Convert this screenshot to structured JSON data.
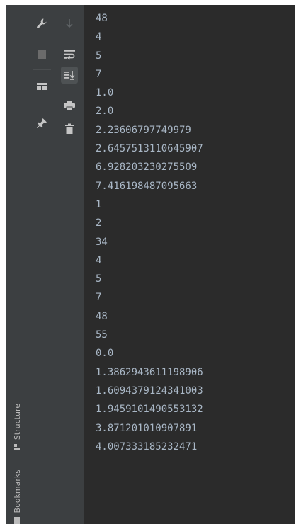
{
  "sidebar": {
    "tabs": [
      {
        "label": "Structure",
        "icon": "structure-icon"
      },
      {
        "label": "Bookmarks",
        "icon": "bookmarks-icon"
      }
    ]
  },
  "toolbar": {
    "col1": [
      {
        "name": "wrench-icon",
        "title": "Settings"
      },
      {
        "name": "stop-icon",
        "title": "Stop"
      },
      {
        "name": "layout-icon",
        "title": "Layout"
      },
      {
        "name": "pin-icon",
        "title": "Pin"
      }
    ],
    "col2": [
      {
        "name": "arrow-down-icon",
        "title": "Down"
      },
      {
        "name": "soft-wrap-icon",
        "title": "Soft-Wrap"
      },
      {
        "name": "scroll-to-end-icon",
        "title": "Scroll to End"
      },
      {
        "name": "print-icon",
        "title": "Print"
      },
      {
        "name": "trash-icon",
        "title": "Clear All"
      }
    ]
  },
  "colors": {
    "console_bg": "#2b2b2b",
    "console_text": "#a9b7c6",
    "panel_bg": "#3c3f41",
    "icon": "#c5c5c5",
    "icon_disabled": "#5f6366",
    "stop_disabled": "#6b6b6b"
  },
  "console": {
    "lines": [
      "48",
      "4",
      "5",
      "7",
      "1.0",
      "2.0",
      "2.23606797749979",
      "2.6457513110645907",
      "6.928203230275509",
      "7.416198487095663",
      "1",
      "2",
      "34",
      "4",
      "5",
      "7",
      "48",
      "55",
      "0.0",
      "1.3862943611198906",
      "1.6094379124341003",
      "1.9459101490553132",
      "3.871201010907891",
      "4.007333185232471"
    ]
  }
}
